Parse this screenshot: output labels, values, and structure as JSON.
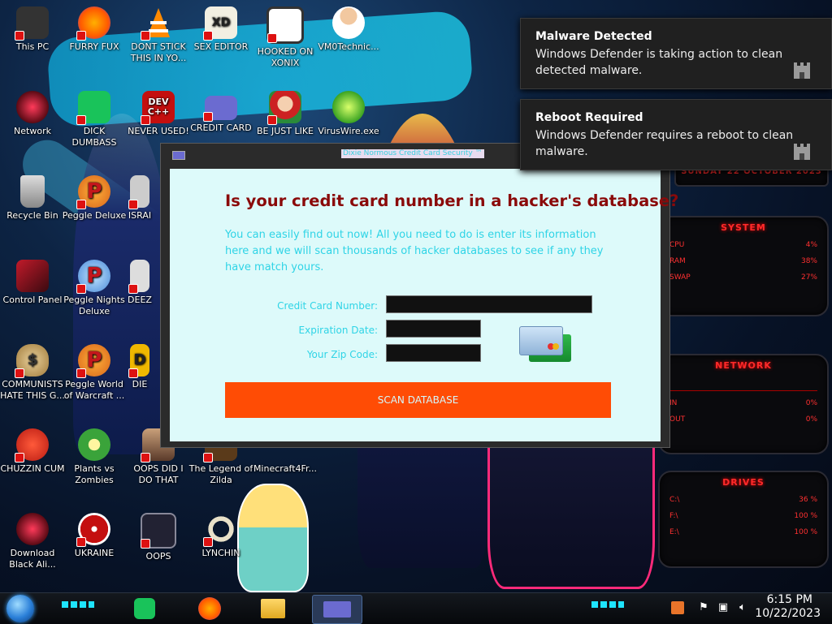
{
  "desktop": {
    "icons": [
      {
        "id": "this-pc",
        "label": "This PC"
      },
      {
        "id": "furry-fux",
        "label": "FURRY FUX"
      },
      {
        "id": "dont-stick",
        "label": "DONT STICK THIS IN YO..."
      },
      {
        "id": "sex-editor",
        "label": "SEX EDITOR",
        "glyph": "XD"
      },
      {
        "id": "hooked-on-xonix",
        "label": "HOOKED ON XONIX"
      },
      {
        "id": "vm0technic",
        "label": "VM0Technic..."
      },
      {
        "id": "network",
        "label": "Network"
      },
      {
        "id": "dick-dumbass",
        "label": "DICK DUMBASS"
      },
      {
        "id": "never-used",
        "label": "NEVER USED!",
        "glyph": "DEV C++"
      },
      {
        "id": "credit-card",
        "label": "CREDIT CARD"
      },
      {
        "id": "be-just-like",
        "label": "BE JUST LIKE"
      },
      {
        "id": "viruswire",
        "label": "VirusWire.exe"
      },
      {
        "id": "recycle-bin",
        "label": "Recycle Bin"
      },
      {
        "id": "peggle-deluxe",
        "label": "Peggle Deluxe",
        "glyph": "P"
      },
      {
        "id": "isra",
        "label": "ISRAI"
      },
      {
        "id": "control-panel",
        "label": "Control Panel"
      },
      {
        "id": "peggle-nights",
        "label": "Peggle Nights Deluxe",
        "glyph": "P"
      },
      {
        "id": "deez",
        "label": "DEEZ"
      },
      {
        "id": "communists",
        "label": "COMMUNISTS HATE THIS G...",
        "glyph": "$"
      },
      {
        "id": "peggle-world",
        "label": "Peggle World of Warcraft ...",
        "glyph": "P"
      },
      {
        "id": "die",
        "label": "DIE",
        "glyph": "D"
      },
      {
        "id": "chuzzin-cum",
        "label": "CHUZZIN CUM"
      },
      {
        "id": "plants-vs-zombies",
        "label": "Plants vs Zombies"
      },
      {
        "id": "oops-did-i",
        "label": "OOPS DID I DO THAT"
      },
      {
        "id": "legend-of-zilda",
        "label": "The Legend of Zilda"
      },
      {
        "id": "minecraft4fr",
        "label": "Minecraft4Fr..."
      },
      {
        "id": "download-black",
        "label": "Download Black Ali..."
      },
      {
        "id": "ukraine",
        "label": "UKRAINE"
      },
      {
        "id": "oops",
        "label": "OOPS"
      },
      {
        "id": "lynching",
        "label": "LYNCHIN"
      }
    ],
    "gadgets": {
      "date_banner": "SUNDAY 22 OCTOBER 2023",
      "system": {
        "title": "SYSTEM",
        "rows": [
          {
            "label": "CPU",
            "value": "4%"
          },
          {
            "label": "RAM",
            "value": "38%"
          },
          {
            "label": "SWAP",
            "value": "27%"
          }
        ]
      },
      "network": {
        "title": "NETWORK",
        "rows": [
          {
            "label": "IN",
            "value": "0%"
          },
          {
            "label": "OUT",
            "value": "0%"
          }
        ]
      },
      "drives": {
        "title": "DRIVES",
        "rows": [
          {
            "label": "C:\\",
            "value": "36 %"
          },
          {
            "label": "F:\\",
            "value": "100 %"
          },
          {
            "label": "E:\\",
            "value": "100 %"
          }
        ]
      }
    }
  },
  "window": {
    "title": "Dixie Normous Credit Card Security ™",
    "headline": "Is your credit card number in a hacker's database?",
    "description": "You can easily find out now! All you need to do is enter its information here and we will scan thousands of hacker databases to see if any they have match yours.",
    "fields": {
      "card_number": {
        "label": "Credit Card Number:",
        "value": ""
      },
      "expiration": {
        "label": "Expiration Date:",
        "value": ""
      },
      "zip": {
        "label": "Your Zip Code:",
        "value": ""
      }
    },
    "scan_button": "SCAN DATABASE"
  },
  "notifications": [
    {
      "title": "Malware Detected",
      "body": "Windows Defender is taking action to clean detected malware."
    },
    {
      "title": "Reboot Required",
      "body": "Windows Defender requires a reboot to clean malware."
    }
  ],
  "taskbar": {
    "clock_time": "6:15 PM",
    "clock_date": "10/22/2023"
  }
}
